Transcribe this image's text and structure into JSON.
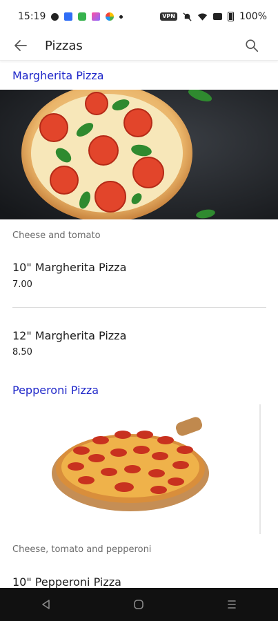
{
  "status_bar": {
    "time": "15:19",
    "vpn_label": "VPN",
    "battery": "100%"
  },
  "app_bar": {
    "title": "Pizzas"
  },
  "sections": [
    {
      "title": "Margherita Pizza",
      "description": "Cheese and tomato",
      "items": [
        {
          "name": "10\" Margherita Pizza",
          "price": "7.00"
        },
        {
          "name": "12\" Margherita Pizza",
          "price": "8.50"
        }
      ]
    },
    {
      "title": "Pepperoni Pizza",
      "description": "Cheese, tomato and pepperoni",
      "items": [
        {
          "name": "10\" Pepperoni Pizza",
          "price": ""
        }
      ]
    }
  ],
  "icons": {
    "back": "arrow-left-icon",
    "search": "search-icon",
    "nav_back": "triangle-back-icon",
    "nav_home": "circle-home-icon",
    "nav_recents": "menu-lines-icon"
  },
  "colors": {
    "section_title": "#1f27c9",
    "nav_bar": "#111111"
  }
}
